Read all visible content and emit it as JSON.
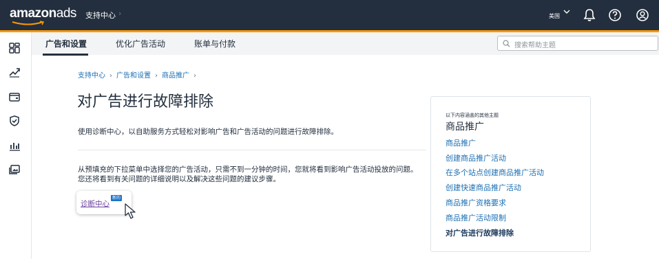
{
  "topbar": {
    "logo_bold": "amazon",
    "logo_light": "ads",
    "support_label": "支持中心",
    "chevron": "›",
    "region": "美国",
    "icons": [
      "chevron-down-icon",
      "bell-icon",
      "help-icon",
      "user-icon"
    ]
  },
  "leftrail": {
    "icons": [
      "dashboard-icon",
      "trend-icon",
      "wallet-icon",
      "shield-icon",
      "bar-chart-icon",
      "gallery-icon"
    ]
  },
  "subnav": {
    "tabs": [
      {
        "label": "广告和设置",
        "active": true
      },
      {
        "label": "优化广告活动",
        "active": false
      },
      {
        "label": "账单与付款",
        "active": false
      }
    ],
    "search_placeholder": "搜索帮助主题"
  },
  "breadcrumb": {
    "items": [
      "支持中心",
      "广告和设置",
      "商品推广"
    ],
    "separator": "›"
  },
  "main": {
    "title": "对广告进行故障排除",
    "intro": "使用诊断中心，以自助服务方式轻松对影响广告和广告活动的问题进行故障排除。",
    "body": "从预填充的下拉菜单中选择您的广告活动，只需不到一分钟的时间，您就将看到影响广告活动投放的问题。您还将看到有关问题的详细说明以及解决这些问题的建议步骤。",
    "diag_link": "诊断中心",
    "diag_badge": "新的"
  },
  "panel": {
    "small_label": "以下内容涵盖的其他主题",
    "heading": "商品推广",
    "links": [
      {
        "label": "商品推广",
        "current": false
      },
      {
        "label": "创建商品推广活动",
        "current": false
      },
      {
        "label": "在多个站点创建商品推广活动",
        "current": false
      },
      {
        "label": "创建快速商品推广活动",
        "current": false
      },
      {
        "label": "商品推广资格要求",
        "current": false
      },
      {
        "label": "商品推广活动限制",
        "current": false
      },
      {
        "label": "对广告进行故障排除",
        "current": true
      }
    ]
  },
  "colors": {
    "topbar": "#232f3e",
    "accent": "#ff9900",
    "link": "#1b6fb3",
    "badge": "#1a73c9"
  }
}
